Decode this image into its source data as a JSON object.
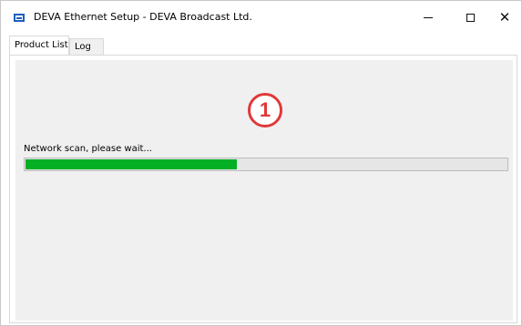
{
  "window": {
    "title": "DEVA Ethernet Setup - DEVA Broadcast Ltd.",
    "app_icon": "monitor-icon",
    "controls": {
      "minimize": "minimize-icon",
      "maximize": "maximize-icon",
      "close_label": "✕"
    }
  },
  "tabs": [
    {
      "label": "Product List",
      "selected": true
    },
    {
      "label": "Log",
      "selected": false
    }
  ],
  "main": {
    "annotation_number": "1",
    "status_text": "Network scan, please wait...",
    "progress_percent": 44
  },
  "colors": {
    "progress_fill": "#06b025",
    "annotation": "#e0383a",
    "panel_background": "#f0f0f0"
  }
}
